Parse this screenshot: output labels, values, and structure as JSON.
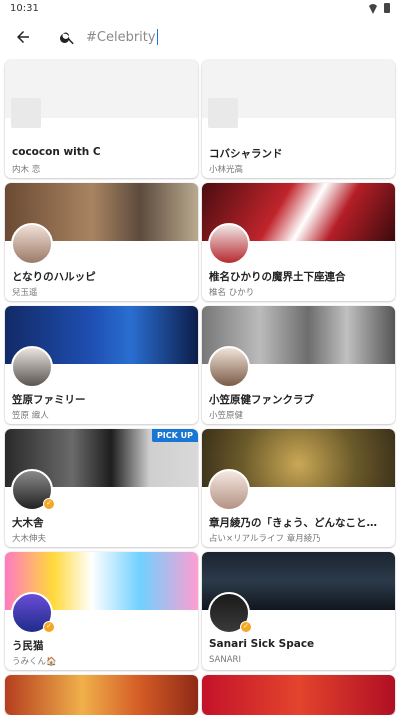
{
  "status": {
    "time": "10:31",
    "wifi_icon": "wifi-icon",
    "battery_icon": "battery-icon"
  },
  "search": {
    "back_icon": "arrow-left-icon",
    "search_icon": "search-icon",
    "placeholder": "#Celebrity"
  },
  "accent": "#1976d2",
  "cards": [
    {
      "title": "cococon with C",
      "subtitle": "内木 恋",
      "cover": "#f3f3f3",
      "avatar": "",
      "badge": false,
      "pickup": ""
    },
    {
      "title": "コバシャランド",
      "subtitle": "小林光高",
      "cover": "#f3f3f3",
      "avatar": "",
      "badge": false,
      "pickup": ""
    },
    {
      "title": "となりのハルッピ",
      "subtitle": "兒玉遥",
      "cover": "linear-gradient(90deg,#6b4a33,#a98462 45%,#5d4b3d 70%,#b9a98e)",
      "avatar": "linear-gradient(#f1dfd5,#9b7a68)",
      "badge": false,
      "pickup": ""
    },
    {
      "title": "椎名ひかりの魔界土下座連合",
      "subtitle": "椎名 ひかり",
      "cover": "linear-gradient(120deg,#4a0d10,#c0242b 40%,#ffffff 55%,#b51e27 70%,#3b0b0d)",
      "avatar": "linear-gradient(#f2e6e6,#b52a2f)",
      "badge": false,
      "pickup": ""
    },
    {
      "title": "笠原ファミリー",
      "subtitle": "笠原 織人",
      "cover": "linear-gradient(90deg,#122a66,#1f4fb2 45%,#2a6ed1 65%,#0d1d4a)",
      "avatar": "linear-gradient(#e8e4e0,#5b5450)",
      "badge": false,
      "pickup": ""
    },
    {
      "title": "小笠原健ファンクラブ",
      "subtitle": "小笠原健",
      "cover": "linear-gradient(90deg,#777,#bbb 30%,#6d6d6d 55%,#c0c0c0 75%,#555)",
      "avatar": "linear-gradient(#f0e3d8,#7a5b47)",
      "badge": false,
      "pickup": ""
    },
    {
      "title": "大木舎",
      "subtitle": "大木伸夫",
      "cover": "linear-gradient(90deg,#2a2a2a,#6a6a6a 35%,#1e1e1e 55%,#cfcfcf 75%,#d9d9d9)",
      "avatar": "linear-gradient(#8a8a8a,#222)",
      "badge": true,
      "pickup": "PICK UP"
    },
    {
      "title": "章月綾乃の「きょう、どんなこと…",
      "subtitle": "占い×リアルライフ 章月綾乃",
      "cover": "radial-gradient(circle at 50% 60%,#caa856,#6b5a2a 55%,#3b301a)",
      "avatar": "linear-gradient(#f4e7e0,#b59283)",
      "badge": false,
      "pickup": ""
    },
    {
      "title": "う民猫",
      "subtitle": "うみくん🏠",
      "cover": "linear-gradient(90deg,#ff7ac1,#ffd93b 25%,#ffffff 45%,#6fd0ff 70%,#ff9ed2)",
      "avatar": "linear-gradient(#6a4cd6,#1e2c8a)",
      "badge": true,
      "pickup": ""
    },
    {
      "title": "Sanari Sick Space",
      "subtitle": "SANARI",
      "cover": "linear-gradient(180deg,#1c2430,#2b3a4a 50%,#11161d)",
      "avatar": "linear-gradient(#1a1a1a,#3a3a3a)",
      "badge": true,
      "pickup": ""
    },
    {
      "title": "",
      "subtitle": "",
      "cover": "linear-gradient(90deg,#b53d1f,#f0b04a 40%,#d45b26 70%,#8e2a16)",
      "avatar": "",
      "badge": false,
      "pickup": ""
    },
    {
      "title": "",
      "subtitle": "",
      "cover": "linear-gradient(90deg,#c4122a,#e3442d 50%,#b00f23)",
      "avatar": "",
      "badge": false,
      "pickup": ""
    }
  ]
}
